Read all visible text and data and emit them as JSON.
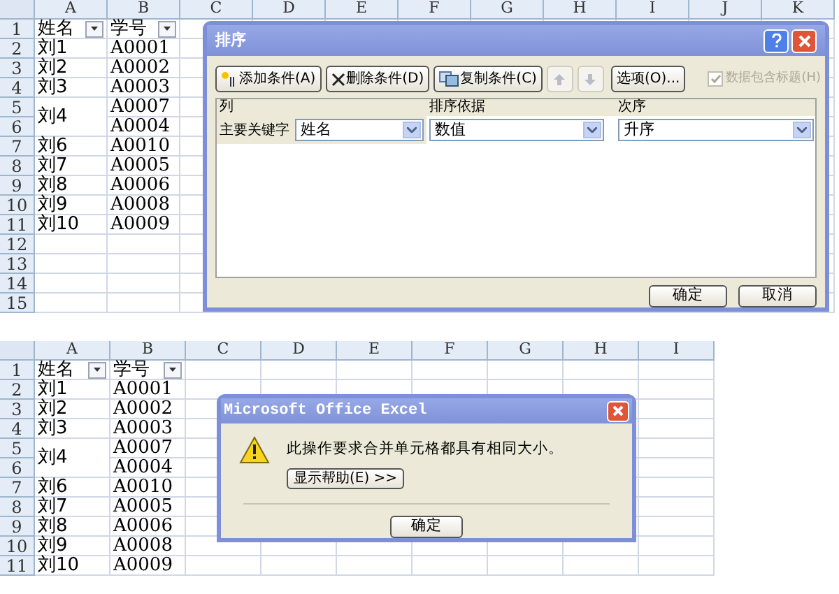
{
  "top_sheet": {
    "columns": [
      "A",
      "B",
      "C",
      "D",
      "E",
      "F",
      "G",
      "H",
      "I",
      "J",
      "K"
    ],
    "rows": [
      {
        "header": "1",
        "a": "姓名",
        "b": "学号",
        "filter": true
      },
      {
        "header": "2",
        "a": "刘1",
        "b": "A0001"
      },
      {
        "header": "3",
        "a": "刘2",
        "b": "A0002"
      },
      {
        "header": "4",
        "a": "刘3",
        "b": "A0003"
      },
      {
        "header": "5",
        "a": "刘4",
        "a_merged_down": true,
        "b": "A0007"
      },
      {
        "header": "6",
        "b": "A0004"
      },
      {
        "header": "7",
        "a": "刘6",
        "b": "A0010"
      },
      {
        "header": "8",
        "a": "刘7",
        "b": "A0005"
      },
      {
        "header": "9",
        "a": "刘8",
        "b": "A0006"
      },
      {
        "header": "10",
        "a": "刘9",
        "b": "A0008"
      },
      {
        "header": "11",
        "a": "刘10",
        "b": "A0009"
      },
      {
        "header": "12"
      },
      {
        "header": "13"
      },
      {
        "header": "14"
      },
      {
        "header": "15"
      }
    ]
  },
  "sort_dialog": {
    "title": "排序",
    "toolbar": [
      {
        "kind": "add",
        "label": "添加条件(A)"
      },
      {
        "kind": "delete",
        "label": "删除条件(D)"
      },
      {
        "kind": "copy",
        "label": "复制条件(C)"
      },
      {
        "kind": "up",
        "disabled": true
      },
      {
        "kind": "down",
        "disabled": true
      },
      {
        "kind": "options",
        "label": "选项(O)..."
      }
    ],
    "header_checkbox": {
      "label": "数据包含标题(H)",
      "checked": true,
      "disabled": true
    },
    "columns": [
      "列",
      "排序依据",
      "次序"
    ],
    "rows": [
      {
        "label": "主要关键字",
        "column": "姓名",
        "sort_on": "数值",
        "order": "升序"
      }
    ],
    "buttons": [
      "确定",
      "取消"
    ]
  },
  "bottom_sheet": {
    "columns": [
      "A",
      "B",
      "C",
      "D",
      "E",
      "F",
      "G",
      "H",
      "I"
    ],
    "rows": [
      {
        "header": "1",
        "a": "姓名",
        "b": "学号",
        "filter": true
      },
      {
        "header": "2",
        "a": "刘1",
        "b": "A0001"
      },
      {
        "header": "3",
        "a": "刘2",
        "b": "A0002"
      },
      {
        "header": "4",
        "a": "刘3",
        "b": "A0003"
      },
      {
        "header": "5",
        "a": "刘4",
        "a_merged_down": true,
        "b": "A0007"
      },
      {
        "header": "6",
        "b": "A0004"
      },
      {
        "header": "7",
        "a": "刘6",
        "b": "A0010"
      },
      {
        "header": "8",
        "a": "刘7",
        "b": "A0005"
      },
      {
        "header": "9",
        "a": "刘8",
        "b": "A0006"
      },
      {
        "header": "10",
        "a": "刘9",
        "b": "A0008"
      },
      {
        "header": "11",
        "a": "刘10",
        "b": "A0009"
      }
    ]
  },
  "message_dialog": {
    "title": "Microsoft Office Excel",
    "message": "此操作要求合并单元格都具有相同大小。",
    "help_button": "显示帮助(E) >>",
    "ok_button": "确定"
  }
}
